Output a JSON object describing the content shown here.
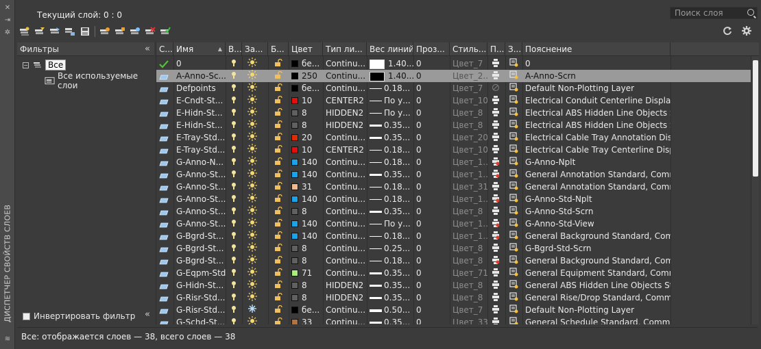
{
  "palette_title": "ДИСПЕТЧЕР СВОЙСТВ СЛОЕВ",
  "current_layer": "Текущий слой: 0 : 0",
  "search": {
    "placeholder": "Поиск слоя"
  },
  "filters": {
    "header": "Фильтры",
    "tree_root": "Все",
    "tree_child": "Все используемые слои",
    "invert_label": "Инвертировать фильтр",
    "invert_checked": false
  },
  "columns": [
    "С...",
    "Имя",
    "В...",
    "За...",
    "Б...",
    "Цвет",
    "Тип ли...",
    "Вес линий",
    "Проз...",
    "Стиль...",
    "П...",
    "З...",
    "Пояснение"
  ],
  "rows": [
    {
      "status": "check",
      "name": "0",
      "color_hex": "#000000",
      "color": "бе...",
      "linetype": "Continu...",
      "lw": "1.40...",
      "lw_style": "big",
      "transp": "0",
      "style": "Цвет_7",
      "plot": "print",
      "desc": "0"
    },
    {
      "status": "layer",
      "name": "A-Anno-Sc...",
      "color_hex": "#000000",
      "color": "250",
      "linetype": "Continu...",
      "lw": "1.40...",
      "lw_style": "big",
      "transp": "0",
      "style": "Цвет_2...",
      "plot": "print",
      "desc": "A-Anno-Scrn",
      "selected": true
    },
    {
      "status": "layer",
      "name": "Defpoints",
      "color_hex": "#000000",
      "color": "бе...",
      "linetype": "Continu...",
      "lw": "0.18...",
      "lw_style": "thin",
      "transp": "0",
      "style": "Цвет_7",
      "plot": "noprint",
      "desc": "Default Non-Plotting Layer"
    },
    {
      "status": "layer",
      "name": "E-Cndt-St...",
      "color_hex": "#e01010",
      "color": "10",
      "linetype": "CENTER2",
      "lw": "По у...",
      "lw_style": "thin",
      "transp": "0",
      "style": "Цвет_10",
      "plot": "print",
      "desc": "Electrical Conduit Centerline Display..."
    },
    {
      "status": "layer",
      "name": "E-Hidn-St...",
      "color_hex": "#606060",
      "color": "8",
      "linetype": "HIDDEN2",
      "lw": "По у...",
      "lw_style": "thin",
      "transp": "0",
      "style": "Цвет_8",
      "plot": "print",
      "desc": "Electrical ABS Hidden Line Objects St..."
    },
    {
      "status": "layer",
      "name": "E-Hidn-St...",
      "color_hex": "#606060",
      "color": "8",
      "linetype": "HIDDEN2",
      "lw": "0.35...",
      "lw_style": "mid",
      "transp": "0",
      "style": "Цвет_8",
      "plot": "print",
      "desc": "Electrical ABS Hidden Line Objects St..."
    },
    {
      "status": "layer",
      "name": "E-Tray-Std...",
      "color_hex": "#e02a00",
      "color": "20",
      "linetype": "Continu...",
      "lw": "0.35...",
      "lw_style": "mid",
      "transp": "0",
      "style": "Цвет_20",
      "plot": "print",
      "desc": "Electrical Cable Tray Annotation Disp..."
    },
    {
      "status": "layer",
      "name": "E-Tray-Std...",
      "color_hex": "#e01010",
      "color": "10",
      "linetype": "CENTER2",
      "lw": "0.18...",
      "lw_style": "thin",
      "transp": "0",
      "style": "Цвет_10",
      "plot": "print",
      "desc": "Electrical Cable Tray Centerline Displ..."
    },
    {
      "status": "layer",
      "name": "G-Anno-N...",
      "color_hex": "#1aa3e8",
      "color": "140",
      "linetype": "Continu...",
      "lw": "0.18...",
      "lw_style": "thin",
      "transp": "0",
      "style": "Цвет_1...",
      "plot": "noplot",
      "desc": "G-Anno-Nplt"
    },
    {
      "status": "layer",
      "name": "G-Anno-St...",
      "color_hex": "#1aa3e8",
      "color": "140",
      "linetype": "Continu...",
      "lw": "0.35...",
      "lw_style": "mid",
      "transp": "0",
      "style": "Цвет_1...",
      "plot": "noplot",
      "desc": "General Annotation Standard, Comm..."
    },
    {
      "status": "layer",
      "name": "G-Anno-St...",
      "color_hex": "#f2b98a",
      "color": "31",
      "linetype": "Continu...",
      "lw": "0.18...",
      "lw_style": "thin",
      "transp": "0",
      "style": "Цвет_31",
      "plot": "print",
      "desc": "General Annotation Standard, Comm..."
    },
    {
      "status": "layer",
      "name": "G-Anno-St...",
      "color_hex": "#1aa3e8",
      "color": "140",
      "linetype": "Continu...",
      "lw": "0.18...",
      "lw_style": "thin",
      "transp": "0",
      "style": "Цвет_1...",
      "plot": "noplot",
      "desc": "G-Anno-Std-Nplt"
    },
    {
      "status": "layer",
      "name": "G-Anno-St...",
      "color_hex": "#606060",
      "color": "8",
      "linetype": "Continu...",
      "lw": "0.35...",
      "lw_style": "mid",
      "transp": "0",
      "style": "Цвет_8",
      "plot": "print",
      "desc": "G-Anno-Std-Scrn"
    },
    {
      "status": "layer",
      "name": "G-Anno-St...",
      "color_hex": "#1aa3e8",
      "color": "140",
      "linetype": "Continu...",
      "lw": "По у...",
      "lw_style": "thin",
      "transp": "0",
      "style": "Цвет_1...",
      "plot": "noplot",
      "desc": "G-Anno-Std-View"
    },
    {
      "status": "layer",
      "name": "G-Bgrd-St...",
      "color_hex": "#1aa3e8",
      "color": "140",
      "linetype": "Continu...",
      "lw": "0.18...",
      "lw_style": "thin",
      "transp": "0",
      "style": "Цвет_1...",
      "plot": "noplot",
      "desc": "General Background Standard, Com..."
    },
    {
      "status": "layer",
      "name": "G-Bgrd-St...",
      "color_hex": "#606060",
      "color": "8",
      "linetype": "Continu...",
      "lw": "0.25...",
      "lw_style": "thin",
      "transp": "0",
      "style": "Цвет_8",
      "plot": "print",
      "desc": "G-Bgrd-Std-Scrn"
    },
    {
      "status": "layer",
      "name": "G-Bgrd-St...",
      "color_hex": "#606060",
      "color": "8",
      "linetype": "Continu...",
      "lw": "0.18...",
      "lw_style": "thin",
      "transp": "0",
      "style": "Цвет_8",
      "plot": "noplot",
      "desc": "General Background Standard, Com..."
    },
    {
      "status": "layer",
      "name": "G-Eqpm-Std",
      "color_hex": "#a8f07a",
      "color": "71",
      "linetype": "Continu...",
      "lw": "0.35...",
      "lw_style": "mid",
      "transp": "0",
      "style": "Цвет_71",
      "plot": "print",
      "desc": "General Equipment Standard, Comm..."
    },
    {
      "status": "layer",
      "name": "G-Hidn-St...",
      "color_hex": "#606060",
      "color": "8",
      "linetype": "HIDDEN2",
      "lw": "0.35...",
      "lw_style": "mid",
      "transp": "0",
      "style": "Цвет_8",
      "plot": "print",
      "desc": "General ABS Hidden Line Objects Sta..."
    },
    {
      "status": "layer",
      "name": "G-Risr-Std...",
      "color_hex": "#606060",
      "color": "8",
      "linetype": "HIDDEN2",
      "lw": "0.35...",
      "lw_style": "mid",
      "transp": "0",
      "style": "Цвет_8",
      "plot": "print",
      "desc": "General Rise/Drop Standard, Comm..."
    },
    {
      "status": "layer",
      "name": "G-Risr-Std...",
      "color_hex": "#000000",
      "color": "бе...",
      "linetype": "Continu...",
      "lw": "0.50...",
      "lw_style": "thick",
      "transp": "0",
      "style": "Цвет_7",
      "plot": "print",
      "desc": "Default Non-Plotting Layer",
      "frozen": true
    },
    {
      "status": "layer",
      "name": "G-Schd-St...",
      "color_hex": "#b5723a",
      "color": "33",
      "linetype": "Continu...",
      "lw": "0.35...",
      "lw_style": "mid",
      "transp": "0",
      "style": "Цвет_33",
      "plot": "print",
      "desc": "General Schedule Standard, Comm..."
    }
  ],
  "status_text": "Все: отображается слоев — 38, всего слоев — 38"
}
